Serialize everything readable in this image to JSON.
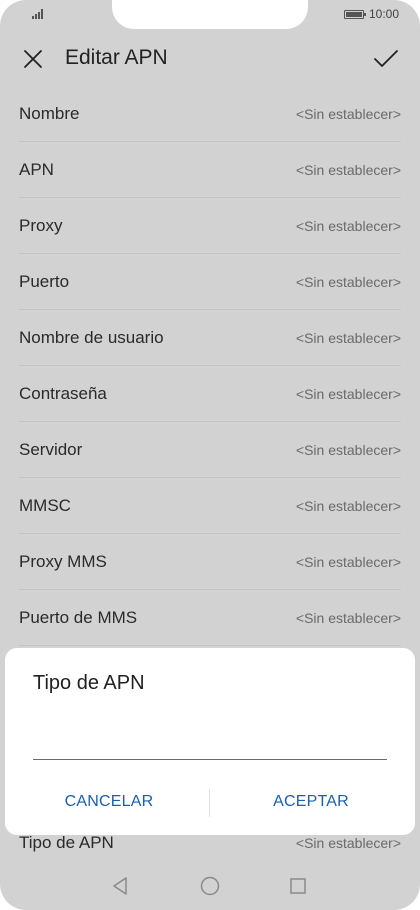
{
  "status_bar": {
    "time": "10:00"
  },
  "header": {
    "title": "Editar APN"
  },
  "apn_fields": [
    {
      "label": "Nombre",
      "value": "<Sin establecer>"
    },
    {
      "label": "APN",
      "value": "<Sin establecer>"
    },
    {
      "label": "Proxy",
      "value": "<Sin establecer>"
    },
    {
      "label": "Puerto",
      "value": "<Sin establecer>"
    },
    {
      "label": "Nombre de usuario",
      "value": "<Sin establecer>"
    },
    {
      "label": "Contraseña",
      "value": "<Sin establecer>"
    },
    {
      "label": "Servidor",
      "value": "<Sin establecer>"
    },
    {
      "label": "MMSC",
      "value": "<Sin establecer>"
    },
    {
      "label": "Proxy MMS",
      "value": "<Sin establecer>"
    },
    {
      "label": "Puerto de MMS",
      "value": "<Sin establecer>"
    }
  ],
  "dialog": {
    "title": "Tipo de APN",
    "input_value": "",
    "cancel_label": "CANCELAR",
    "accept_label": "ACEPTAR"
  },
  "last_field": {
    "label": "Tipo de APN",
    "value": "<Sin establecer>"
  },
  "icons": {
    "close": "close-icon",
    "confirm": "check-icon",
    "back": "back-triangle-icon",
    "home": "home-circle-icon",
    "recent": "recent-square-icon"
  },
  "colors": {
    "dim_background": "#d2d2d2",
    "dialog_button": "#1a5fb4"
  }
}
